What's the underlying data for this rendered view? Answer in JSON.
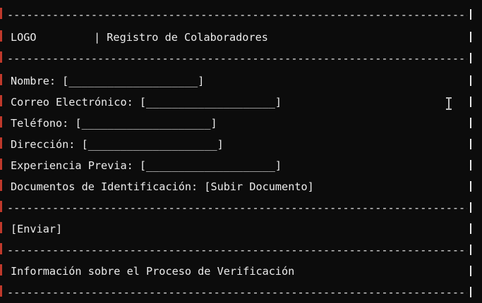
{
  "header": {
    "logo": "LOGO",
    "title": "| Registro de Colaboradores"
  },
  "form": {
    "fields": [
      {
        "label": "Nombre:",
        "value": "[____________________]"
      },
      {
        "label": "Correo Electrónico:",
        "value": "[____________________]"
      },
      {
        "label": "Teléfono:",
        "value": "[____________________]"
      },
      {
        "label": "Dirección:",
        "value": "[____________________]"
      },
      {
        "label": "Experiencia Previa:",
        "value": "[____________________]"
      },
      {
        "label": "Documentos de Identificación:",
        "value": "[Subir Documento]"
      }
    ]
  },
  "actions": {
    "submit_label": "[Enviar]"
  },
  "footer": {
    "info_text": "Información sobre el Proceso de Verificación"
  },
  "colors": {
    "background": "#0c0c0c",
    "text": "#e8e8e8",
    "accent_bar": "#c0392b"
  }
}
